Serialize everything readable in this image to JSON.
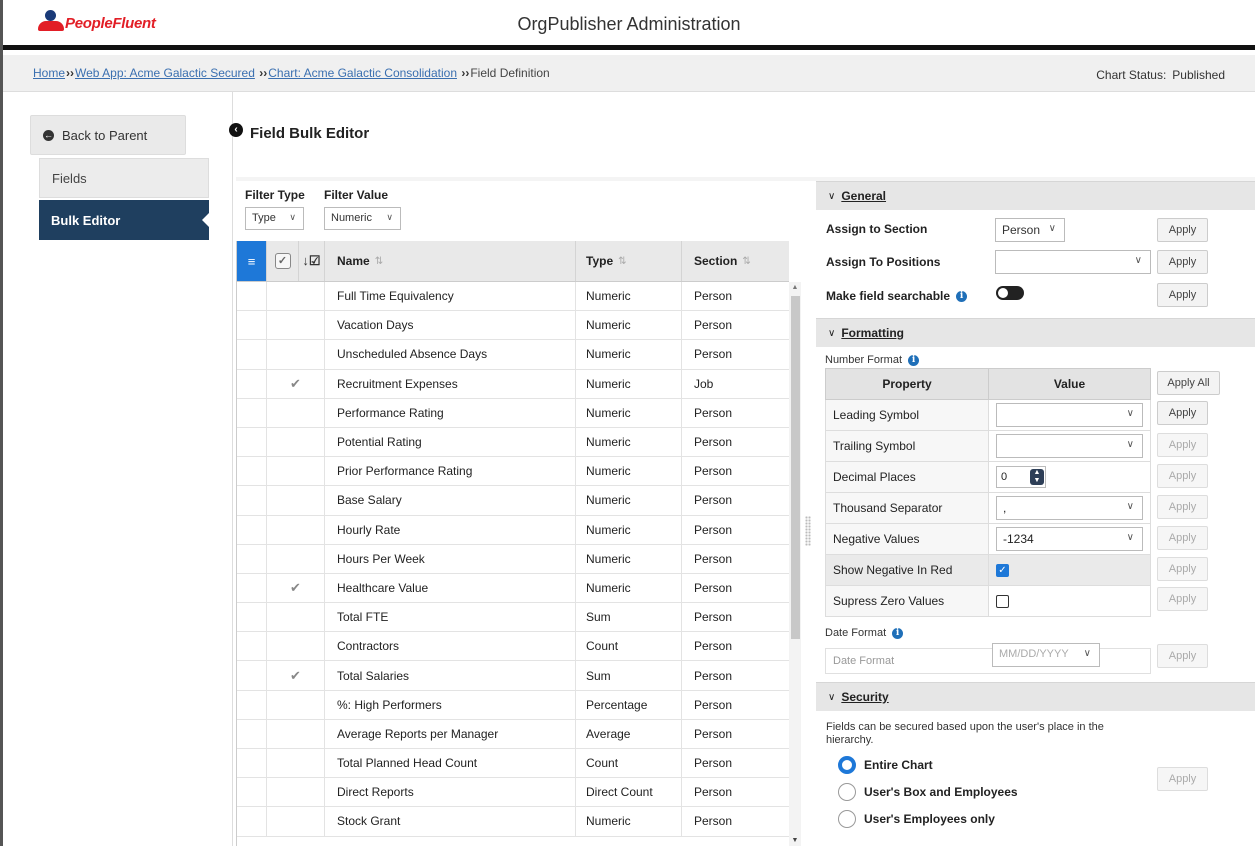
{
  "header": {
    "logo_text": "PeopleFluent",
    "app_title": "OrgPublisher Administration"
  },
  "breadcrumb": {
    "items": [
      "Home",
      "Web App: Acme Galactic Secured",
      "Chart: Acme Galactic Consolidation"
    ],
    "current": "Field Definition",
    "separator": "»"
  },
  "chart_status": {
    "label": "Chart Status:",
    "value": "Published"
  },
  "nav": {
    "back_label": "Back to Parent",
    "fields_label": "Fields",
    "bulk_label": "Bulk Editor"
  },
  "page_title": "Field Bulk Editor",
  "filters": {
    "type_label": "Filter Type",
    "value_label": "Filter Value",
    "type_selected": "Type",
    "value_selected": "Numeric"
  },
  "grid": {
    "columns": {
      "name": "Name",
      "type": "Type",
      "section": "Section"
    },
    "rows": [
      {
        "name": "Full Time Equivalency",
        "type": "Numeric",
        "section": "Person",
        "checked": false
      },
      {
        "name": "Vacation Days",
        "type": "Numeric",
        "section": "Person",
        "checked": false
      },
      {
        "name": "Unscheduled Absence Days",
        "type": "Numeric",
        "section": "Person",
        "checked": false
      },
      {
        "name": "Recruitment Expenses",
        "type": "Numeric",
        "section": "Job",
        "checked": true
      },
      {
        "name": "Performance Rating",
        "type": "Numeric",
        "section": "Person",
        "checked": false
      },
      {
        "name": "Potential Rating",
        "type": "Numeric",
        "section": "Person",
        "checked": false
      },
      {
        "name": "Prior Performance Rating",
        "type": "Numeric",
        "section": "Person",
        "checked": false
      },
      {
        "name": "Base Salary",
        "type": "Numeric",
        "section": "Person",
        "checked": false
      },
      {
        "name": "Hourly Rate",
        "type": "Numeric",
        "section": "Person",
        "checked": false
      },
      {
        "name": "Hours Per Week",
        "type": "Numeric",
        "section": "Person",
        "checked": false
      },
      {
        "name": "Healthcare Value",
        "type": "Numeric",
        "section": "Person",
        "checked": true
      },
      {
        "name": "Total FTE",
        "type": "Sum",
        "section": "Person",
        "checked": false
      },
      {
        "name": "Contractors",
        "type": "Count",
        "section": "Person",
        "checked": false
      },
      {
        "name": "Total Salaries",
        "type": "Sum",
        "section": "Person",
        "checked": true
      },
      {
        "name": "%: High Performers",
        "type": "Percentage",
        "section": "Person",
        "checked": false
      },
      {
        "name": "Average Reports per Manager",
        "type": "Average",
        "section": "Person",
        "checked": false
      },
      {
        "name": "Total Planned Head Count",
        "type": "Count",
        "section": "Person",
        "checked": false
      },
      {
        "name": "Direct Reports",
        "type": "Direct Count",
        "section": "Person",
        "checked": false
      },
      {
        "name": "Stock Grant",
        "type": "Numeric",
        "section": "Person",
        "checked": false
      }
    ]
  },
  "general": {
    "title": "General",
    "assign_section_label": "Assign to Section",
    "assign_section_value": "Person",
    "assign_positions_label": "Assign To Positions",
    "assign_positions_value": "",
    "searchable_label": "Make field searchable",
    "apply": "Apply"
  },
  "formatting": {
    "title": "Formatting",
    "number_format_label": "Number Format",
    "col_property": "Property",
    "col_value": "Value",
    "apply_all": "Apply All",
    "apply": "Apply",
    "leading_symbol": "Leading Symbol",
    "trailing_symbol": "Trailing Symbol",
    "decimal_places": "Decimal Places",
    "decimal_value": "0",
    "thousand_separator": "Thousand Separator",
    "thousand_value": ",",
    "negative_values": "Negative Values",
    "negative_value": "-1234",
    "show_negative_red": "Show Negative In Red",
    "supress_zero": "Supress Zero Values",
    "date_format_label": "Date Format",
    "date_format_field": "Date Format",
    "date_format_value": "MM/DD/YYYY"
  },
  "security": {
    "title": "Security",
    "description": "Fields can be secured based upon the user's place in the hierarchy.",
    "options": [
      "Entire Chart",
      "User's Box and Employees",
      "User's Employees only"
    ],
    "apply": "Apply"
  }
}
